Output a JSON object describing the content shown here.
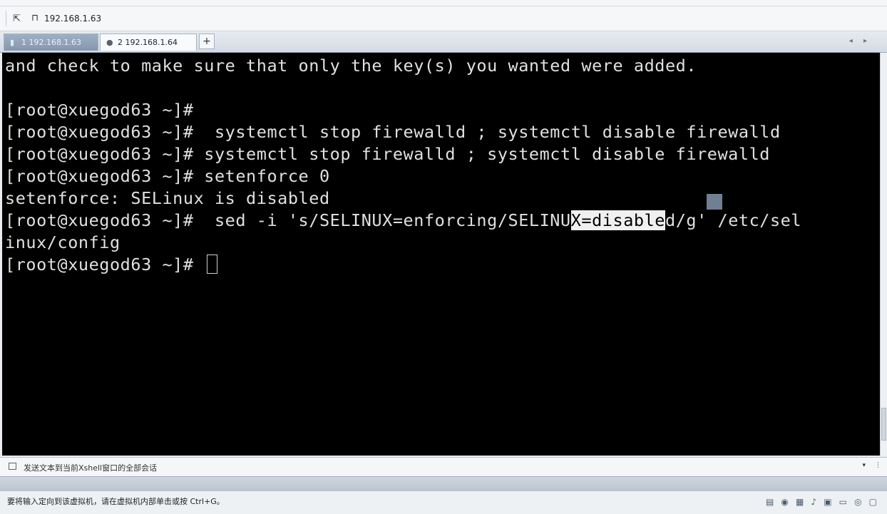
{
  "window": {
    "top_faint": "connection session list",
    "address": "192.168.1.63"
  },
  "tabs": [
    {
      "label": "1 192.168.1.63",
      "active": false
    },
    {
      "label": "2 192.168.1.64",
      "active": true
    }
  ],
  "tab_add": "+",
  "tab_nav": "◂ ▸",
  "terminal": {
    "lines": [
      "and check to make sure that only the key(s) you wanted were added.",
      "",
      "[root@xuegod63 ~]#",
      "[root@xuegod63 ~]#  systemctl stop firewalld ; systemctl disable firewalld",
      "[root@xuegod63 ~]# systemctl stop firewalld ; systemctl disable firewalld",
      "[root@xuegod63 ~]# setenforce 0",
      "setenforce: SELinux is disabled"
    ],
    "sed_prefix": "[root@xuegod63 ~]#  sed -i 's/SELINUX=enforcing/SELINU",
    "sed_selected": "X=disable",
    "sed_suffix": "d/g' /etc/sel",
    "sed_wrap": "inux/config",
    "prompt": "[root@xuegod63 ~]# "
  },
  "compose_bar": {
    "text": "发送文本到当前Xshell窗口的全部会话"
  },
  "status_bar": {
    "text": "要将输入定向到该虚拟机，请在虚拟机内部单击或按 Ctrl+G。"
  },
  "colors": {
    "terminal_bg": "#000000",
    "terminal_fg": "#e0e0e0",
    "selection_bg": "#f0f0f0"
  }
}
